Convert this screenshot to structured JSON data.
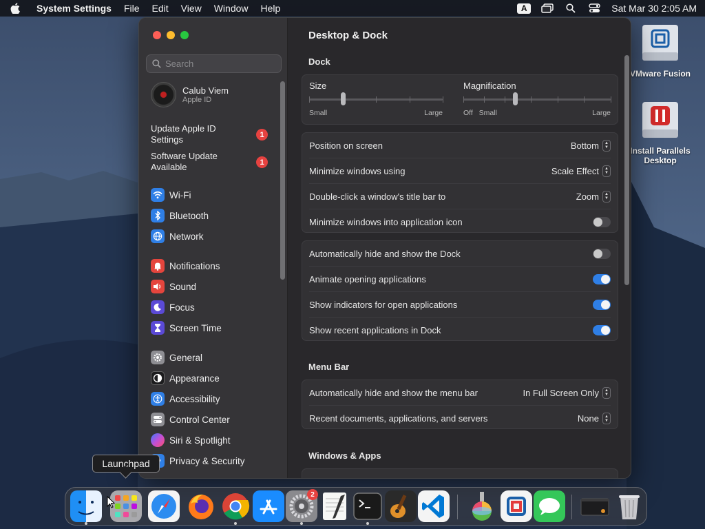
{
  "menubar": {
    "app_name": "System Settings",
    "items": [
      "File",
      "Edit",
      "View",
      "Window",
      "Help"
    ],
    "input_source": "A",
    "clock": "Sat Mar 30  2:05 AM"
  },
  "desktop": {
    "icons": [
      {
        "label": "VMware Fusion"
      },
      {
        "label": "Install Parallels Desktop"
      }
    ]
  },
  "sidebar": {
    "search_placeholder": "Search",
    "account": {
      "name": "Calub Viem",
      "subtitle": "Apple ID"
    },
    "notices": [
      {
        "label": "Update Apple ID Settings",
        "badge": "1"
      },
      {
        "label": "Software Update Available",
        "badge": "1"
      }
    ],
    "items": [
      {
        "label": "Wi-Fi",
        "icon": "wifi-icon",
        "color": "#2f7fe6"
      },
      {
        "label": "Bluetooth",
        "icon": "bluetooth-icon",
        "color": "#2f7fe6"
      },
      {
        "label": "Network",
        "icon": "globe-icon",
        "color": "#2f7fe6"
      },
      {
        "label": "Notifications",
        "icon": "bell-icon",
        "color": "#e5453d"
      },
      {
        "label": "Sound",
        "icon": "speaker-icon",
        "color": "#e5453d"
      },
      {
        "label": "Focus",
        "icon": "moon-icon",
        "color": "#5b4ad6"
      },
      {
        "label": "Screen Time",
        "icon": "hourglass-icon",
        "color": "#5b4ad6"
      },
      {
        "label": "General",
        "icon": "gear-icon",
        "color": "#8e8e93"
      },
      {
        "label": "Appearance",
        "icon": "appearance-icon",
        "color": "#1c1c1e"
      },
      {
        "label": "Accessibility",
        "icon": "accessibility-icon",
        "color": "#2f7fe6"
      },
      {
        "label": "Control Center",
        "icon": "control-center-icon",
        "color": "#8e8e93"
      },
      {
        "label": "Siri & Spotlight",
        "icon": "siri-icon",
        "color": "#c14fd6"
      },
      {
        "label": "Privacy & Security",
        "icon": "hand-icon",
        "color": "#2f7fe6"
      }
    ]
  },
  "content": {
    "title": "Desktop & Dock",
    "dock_section": "Dock",
    "size": {
      "label": "Size",
      "min": "Small",
      "max": "Large",
      "value": 0.25
    },
    "magnification": {
      "label": "Magnification",
      "off": "Off",
      "min": "Small",
      "max": "Large",
      "value": 0.35
    },
    "group1": [
      {
        "label": "Position on screen",
        "value": "Bottom"
      },
      {
        "label": "Minimize windows using",
        "value": "Scale Effect"
      },
      {
        "label": "Double-click a window's title bar to",
        "value": "Zoom"
      },
      {
        "label": "Minimize windows into application icon",
        "toggle": false
      }
    ],
    "group2": [
      {
        "label": "Automatically hide and show the Dock",
        "toggle": false
      },
      {
        "label": "Animate opening applications",
        "toggle": true
      },
      {
        "label": "Show indicators for open applications",
        "toggle": true
      },
      {
        "label": "Show recent applications in Dock",
        "toggle": true
      }
    ],
    "menubar_section": "Menu Bar",
    "group3": [
      {
        "label": "Automatically hide and show the menu bar",
        "value": "In Full Screen Only"
      },
      {
        "label": "Recent documents, applications, and servers",
        "value": "None"
      }
    ],
    "windows_section": "Windows & Apps"
  },
  "tooltip": {
    "label": "Launchpad"
  },
  "dock": {
    "apps": [
      {
        "name": "finder-icon",
        "running": true
      },
      {
        "name": "launchpad-icon",
        "running": false
      },
      {
        "name": "safari-icon",
        "running": false
      },
      {
        "name": "firefox-icon",
        "running": false
      },
      {
        "name": "chrome-icon",
        "running": true
      },
      {
        "name": "app-store-icon",
        "running": false
      },
      {
        "name": "system-settings-icon",
        "running": true,
        "badge": "2"
      },
      {
        "name": "textedit-icon",
        "running": false
      },
      {
        "name": "terminal-icon",
        "running": true
      },
      {
        "name": "garageband-icon",
        "running": false
      },
      {
        "name": "vscode-icon",
        "running": false
      },
      {
        "name": "disk-utility-icon",
        "running": false
      },
      {
        "name": "vmware-icon",
        "running": false
      },
      {
        "name": "messages-icon",
        "running": false
      },
      {
        "name": "minimized-window-icon",
        "running": false
      },
      {
        "name": "trash-icon",
        "running": false
      }
    ]
  }
}
